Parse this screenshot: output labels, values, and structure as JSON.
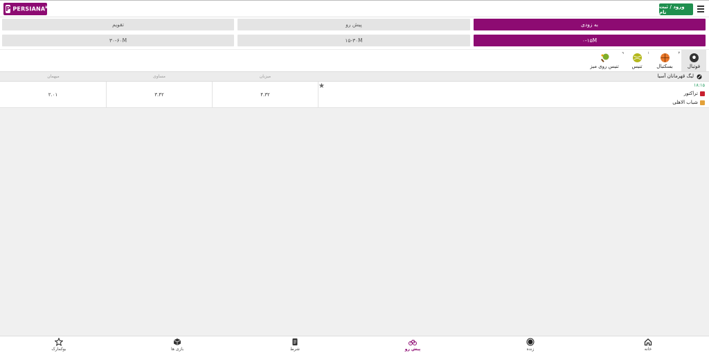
{
  "header": {
    "logo_text": "PERSIANA",
    "logo_sup": "BET",
    "logo_mark": "P",
    "login_label": "ورود / ثبت نام"
  },
  "filters": {
    "row1": [
      "به زودی",
      "پیش رو",
      "تقویم"
    ],
    "row2": [
      "۰-۱۵M",
      "۱۵-۳۰M",
      "۳۰-۶۰M"
    ]
  },
  "sports": [
    {
      "label": "فوتبال",
      "count": "۳",
      "icon": "soccer-ball-icon"
    },
    {
      "label": "بسکتبال",
      "count": "۱",
      "icon": "basketball-icon"
    },
    {
      "label": "تنیس",
      "count": "",
      "icon": "tennis-ball-icon"
    },
    {
      "label": "تنیس روی میز",
      "count": "۹",
      "icon": "table-tennis-icon"
    }
  ],
  "table": {
    "columns": [
      "میزبان",
      "مساوی",
      "میهمان"
    ],
    "league": "لیگ قهرمانان آسیا"
  },
  "match": {
    "time": "۱۸:۱۵",
    "home": "تراکتور",
    "away": "شباب الاهلی",
    "odds": {
      "home": "۴.۳۲",
      "draw": "۳.۴۲",
      "away": "۲.۰۱"
    }
  },
  "nav": [
    {
      "label": "خانه",
      "icon": "home-icon"
    },
    {
      "label": "زنده",
      "icon": "live-icon"
    },
    {
      "label": "پیش رو",
      "icon": "upcoming-icon"
    },
    {
      "label": "شرط",
      "icon": "betslip-icon"
    },
    {
      "label": "بازی ها",
      "icon": "games-cube-icon"
    },
    {
      "label": "بوکمارک",
      "icon": "star-icon"
    }
  ],
  "colors": {
    "brand": "#8d0b72",
    "login": "#1f8f4e",
    "time": "#1f9a5c"
  }
}
